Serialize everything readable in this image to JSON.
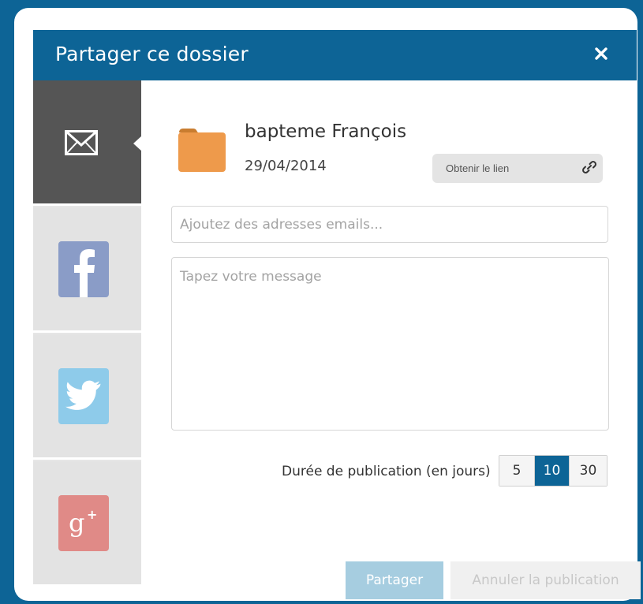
{
  "dialog": {
    "title": "Partager ce dossier",
    "close_symbol": "×"
  },
  "sidebar": {
    "items": [
      {
        "name": "email",
        "icon": "envelope-icon",
        "active": true
      },
      {
        "name": "facebook",
        "icon": "facebook-icon",
        "color": "#8a9cc7"
      },
      {
        "name": "twitter",
        "icon": "twitter-icon",
        "color": "#8ecbea"
      },
      {
        "name": "google-plus",
        "icon": "google-plus-icon",
        "color": "#e08a87"
      }
    ]
  },
  "folder": {
    "name": "bapteme François",
    "date": "29/04/2014",
    "icon": "folder-icon",
    "color": "#ee9a4b"
  },
  "link_button": {
    "label": "Obtenir le lien",
    "icon": "link-icon"
  },
  "form": {
    "email_placeholder": "Ajoutez des adresses emails...",
    "email_value": "",
    "message_placeholder": "Tapez votre message",
    "message_value": ""
  },
  "duration": {
    "label": "Durée de publication (en jours)",
    "options": [
      "5",
      "10",
      "30"
    ],
    "selected": "10"
  },
  "actions": {
    "share_label": "Partager",
    "cancel_label": "Annuler la publication"
  },
  "colors": {
    "primary": "#0d6496",
    "share_disabled": "#a6cde0"
  }
}
